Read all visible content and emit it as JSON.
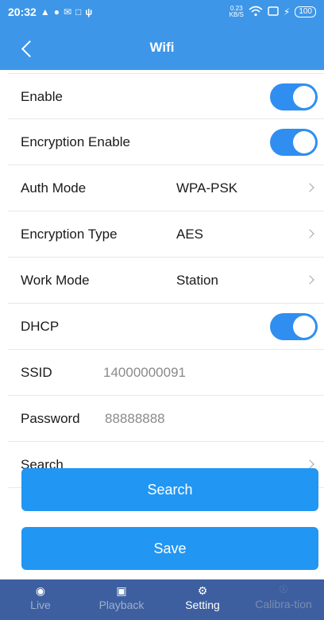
{
  "status_bar": {
    "time": "20:32",
    "left_icons": [
      "ticket-icon",
      "location-icon",
      "mail-icon",
      "message-icon",
      "usb-icon"
    ],
    "net_speed_value": "0.23",
    "net_speed_unit": "KB/S",
    "battery": "100"
  },
  "header": {
    "title": "Wifi"
  },
  "settings": {
    "enable": {
      "label": "Enable",
      "on": true
    },
    "encryption_enable": {
      "label": "Encryption Enable",
      "on": true
    },
    "auth_mode": {
      "label": "Auth Mode",
      "value": "WPA-PSK"
    },
    "encryption_type": {
      "label": "Encryption Type",
      "value": "AES"
    },
    "work_mode": {
      "label": "Work Mode",
      "value": "Station"
    },
    "dhcp": {
      "label": "DHCP",
      "on": true
    },
    "ssid": {
      "label": "SSID",
      "value": "14000000091"
    },
    "password": {
      "label": "Password",
      "value": "88888888"
    },
    "search_row": {
      "label": "Search"
    }
  },
  "buttons": {
    "search": "Search",
    "save": "Save"
  },
  "tabbar": {
    "tabs": [
      {
        "label": "Live",
        "icon": "camera-icon"
      },
      {
        "label": "Playback",
        "icon": "image-icon"
      },
      {
        "label": "Setting",
        "icon": "gear-icon"
      },
      {
        "label": "Calibra-tion",
        "icon": "info-icon"
      }
    ]
  },
  "colors": {
    "header": "#3d96e8",
    "toggle_on": "#2f8ef0",
    "button": "#2196f3",
    "tabbar": "#3d5fa0"
  }
}
